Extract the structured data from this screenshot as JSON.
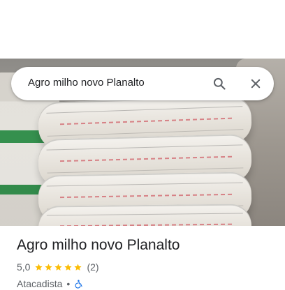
{
  "search": {
    "query": "Agro milho novo Planalto",
    "search_icon": "search-icon",
    "close_icon": "close-icon"
  },
  "place": {
    "name": "Agro milho novo Planalto",
    "rating": "5,0",
    "stars": 5,
    "review_count": "(2)",
    "category": "Atacadista",
    "separator": "•",
    "accessibility_icon": "wheelchair-icon"
  },
  "colors": {
    "star": "#fbbc04",
    "text_primary": "#202124",
    "text_secondary": "#5f6368",
    "accessibility": "#1a73e8"
  }
}
